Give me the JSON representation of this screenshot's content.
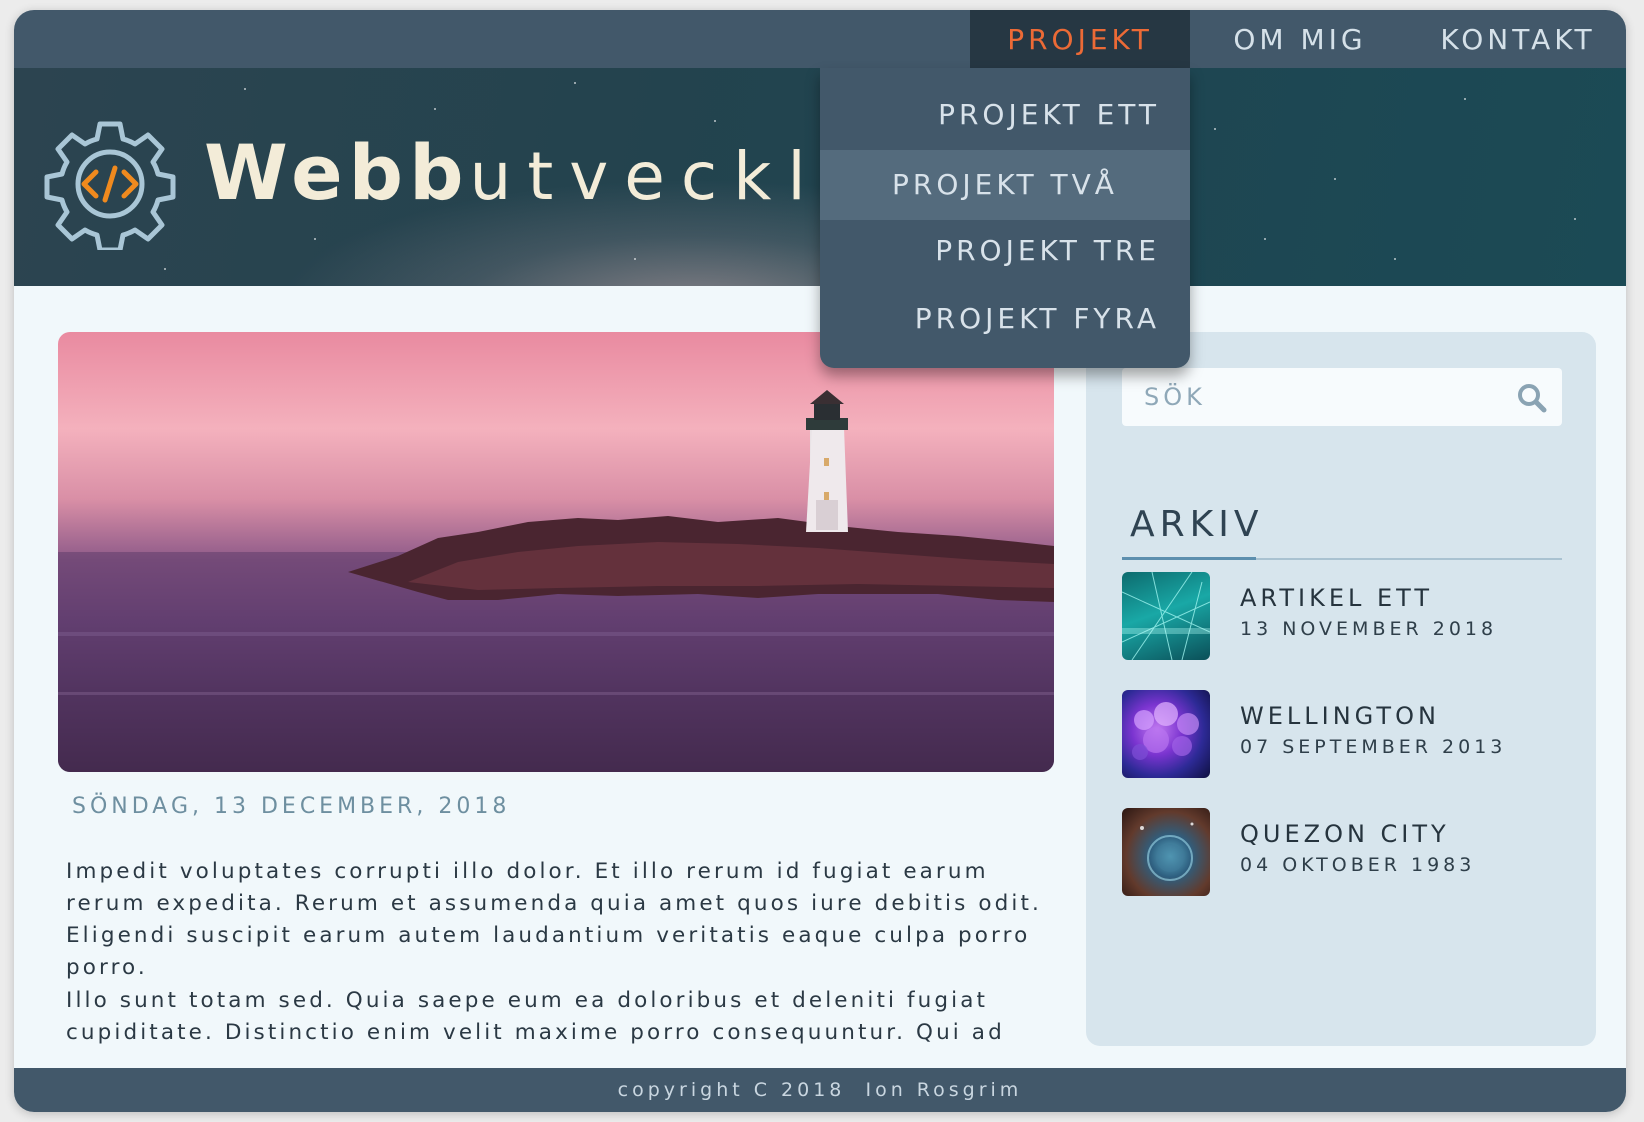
{
  "nav": {
    "items": [
      "PROJEKT",
      "OM MIG",
      "KONTAKT"
    ],
    "active_color": "#ec6a36"
  },
  "dropdown": {
    "items": [
      "PROJEKT ETT",
      "PROJEKT TVÅ",
      "PROJEKT TRE",
      "PROJEKT FYRA"
    ]
  },
  "header": {
    "logo_icon": "gear-code-icon",
    "title_bold": "Webb",
    "title_thin": "utveckling"
  },
  "article": {
    "date": "SÖNDAG, 13 DECEMBER, 2018",
    "paragraphs": [
      "Impedit voluptates corrupti illo dolor. Et illo rerum id fugiat earum rerum expedita. Rerum et assumenda quia amet quos iure debitis odit. Eligendi suscipit earum autem laudantium veritatis eaque culpa porro porro.",
      "Illo sunt totam sed. Quia saepe eum ea doloribus et deleniti fugiat cupiditate. Distinctio enim velit maxime porro consequuntur. Qui ad"
    ]
  },
  "sidebar": {
    "search": {
      "placeholder": "SÖK",
      "icon": "search-icon"
    },
    "archive_title": "ARKIV",
    "archive": [
      {
        "title": "ARTIKEL ETT",
        "date": "13 NOVEMBER 2018"
      },
      {
        "title": "WELLINGTON",
        "date": "07 SEPTEMBER 2013"
      },
      {
        "title": "QUEZON CITY",
        "date": "04 OKTOBER 1983"
      }
    ]
  },
  "footer": {
    "text": "copyright C 2018  Ion Rosgrim"
  },
  "colors": {
    "nav_bg": "#42586a",
    "accent": "#ec6a36",
    "sidebar_bg": "#d7e5ed",
    "page_bg": "#f1f8fb"
  }
}
